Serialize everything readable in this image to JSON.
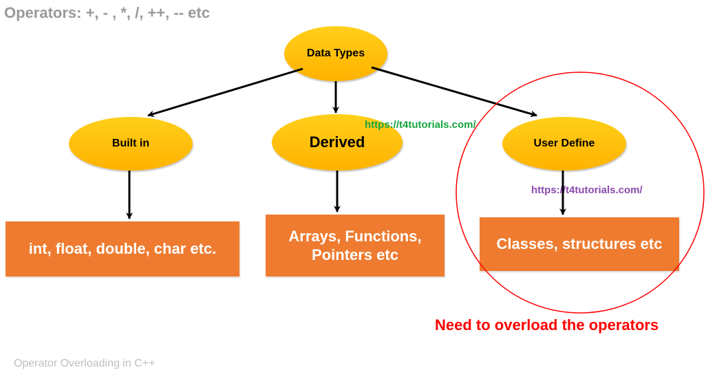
{
  "header": {
    "operators_text": "Operators: +, - , *, /, ++, -- etc"
  },
  "root": {
    "label": "Data Types"
  },
  "children": {
    "builtin": {
      "label": "Built in",
      "examples": "int, float, double, char etc."
    },
    "derived": {
      "label": "Derived",
      "examples": "Arrays, Functions, Pointers etc"
    },
    "userdefine": {
      "label": "User Define",
      "examples": "Classes, structures etc"
    }
  },
  "watermarks": {
    "green": "https://t4tutorials.com/",
    "purple": "https://t4tutorials.com/"
  },
  "callout": {
    "red_text": "Need to overload the operators"
  },
  "footer": {
    "caption": "Operator Overloading in C++"
  }
}
